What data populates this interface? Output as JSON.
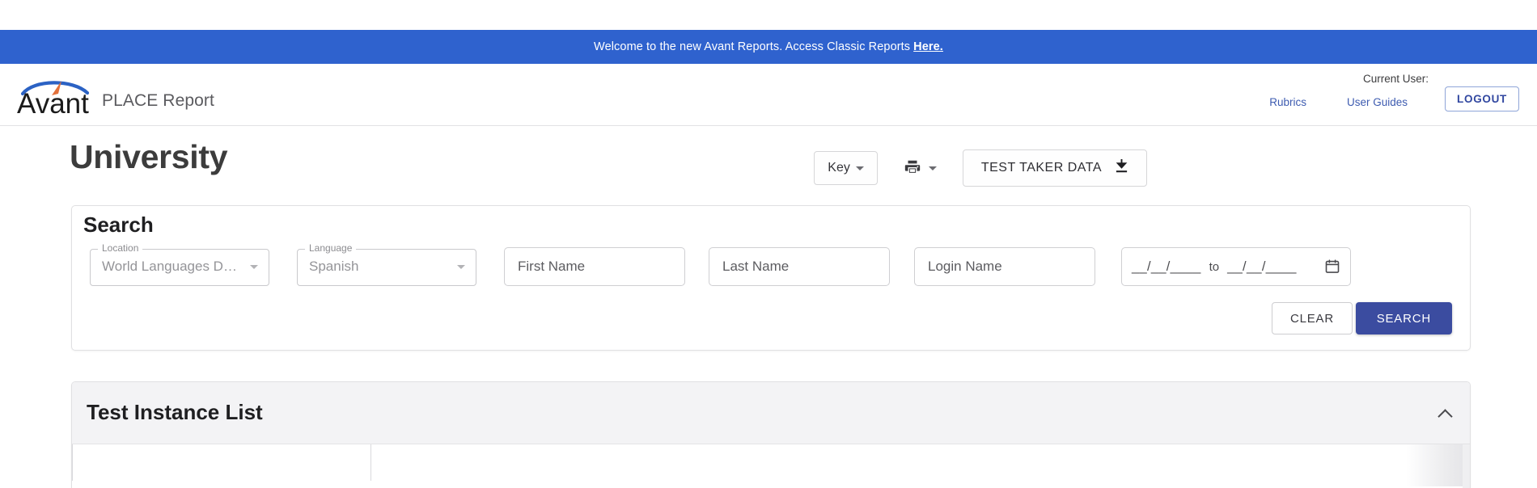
{
  "announcement": {
    "message": "Welcome to the new Avant Reports. Access Classic Reports",
    "link_label": "Here.",
    "background_color": "#2f62ce"
  },
  "header": {
    "brand_name": "Avant",
    "brand_subtitle": "PLACE Report",
    "current_user_label": "Current User:",
    "links": [
      {
        "label": "Rubrics"
      },
      {
        "label": "User Guides"
      }
    ],
    "logout_label": "LOGOUT"
  },
  "page": {
    "title": "University"
  },
  "toolbar": {
    "key_label": "Key",
    "print_icon": "printer-icon",
    "test_taker_data_label": "TEST TAKER DATA",
    "download_icon": "download-icon"
  },
  "search": {
    "heading": "Search",
    "location": {
      "label": "Location",
      "value": "World Languages D…"
    },
    "language": {
      "label": "Language",
      "value": "Spanish"
    },
    "first_name_placeholder": "First Name",
    "first_name_value": "",
    "last_name_placeholder": "Last Name",
    "last_name_value": "",
    "login_name_placeholder": "Login Name",
    "login_name_value": "",
    "date_from": "__/__/____",
    "date_separator": "to",
    "date_to": "__/__/____",
    "calendar_icon": "calendar-icon",
    "clear_label": "CLEAR",
    "search_label": "SEARCH",
    "search_button_color": "#3b4ca0"
  },
  "test_instance_list": {
    "title": "Test Instance List",
    "collapse_icon": "chevron-up-icon"
  }
}
